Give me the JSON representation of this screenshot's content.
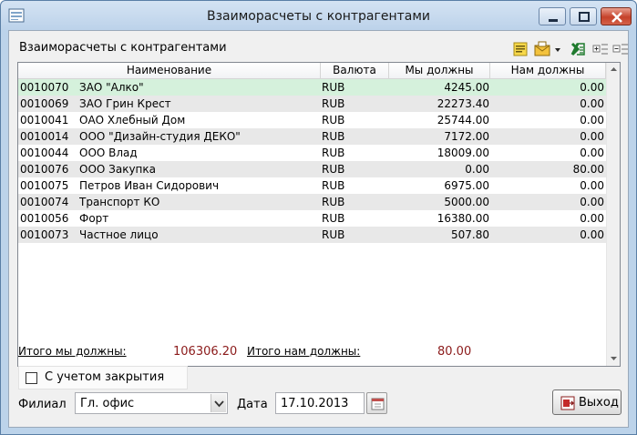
{
  "window": {
    "title": "Взаиморасчеты с контрагентами"
  },
  "panel": {
    "title": "Взаиморасчеты с контрагентами"
  },
  "toolbar": {
    "icons": [
      "note-icon",
      "mail-icon",
      "dropdown-arrow-icon",
      "excel-icon",
      "expand-icon",
      "collapse-icon"
    ]
  },
  "grid": {
    "columns": {
      "name": "Наименование",
      "currency": "Валюта",
      "we_owe": "Мы должны",
      "they_owe": "Нам должны"
    },
    "rows": [
      {
        "code": "0010070",
        "name": "ЗАО \"Алко\"",
        "currency": "RUB",
        "we_owe": "4245.00",
        "they_owe": "0.00"
      },
      {
        "code": "0010069",
        "name": "ЗАО Грин Крест",
        "currency": "RUB",
        "we_owe": "22273.40",
        "they_owe": "0.00"
      },
      {
        "code": "0010041",
        "name": "ОАО Хлебный Дом",
        "currency": "RUB",
        "we_owe": "25744.00",
        "they_owe": "0.00"
      },
      {
        "code": "0010014",
        "name": "ООО \"Дизайн-студия ДЕКО\"",
        "currency": "RUB",
        "we_owe": "7172.00",
        "they_owe": "0.00"
      },
      {
        "code": "0010044",
        "name": "ООО Влад",
        "currency": "RUB",
        "we_owe": "18009.00",
        "they_owe": "0.00"
      },
      {
        "code": "0010076",
        "name": "ООО Закупка",
        "currency": "RUB",
        "we_owe": "0.00",
        "they_owe": "80.00"
      },
      {
        "code": "0010075",
        "name": "Петров Иван Сидорович",
        "currency": "RUB",
        "we_owe": "6975.00",
        "they_owe": "0.00"
      },
      {
        "code": "0010074",
        "name": "Транспорт КО",
        "currency": "RUB",
        "we_owe": "5000.00",
        "they_owe": "0.00"
      },
      {
        "code": "0010056",
        "name": "Форт",
        "currency": "RUB",
        "we_owe": "16380.00",
        "they_owe": "0.00"
      },
      {
        "code": "0010073",
        "name": "Частное лицо",
        "currency": "RUB",
        "we_owe": "507.80",
        "they_owe": "0.00"
      }
    ]
  },
  "summary": {
    "we_owe_label": "Итого мы должны:",
    "we_owe_value": "106306.20",
    "they_owe_label": "Итого нам должны:",
    "they_owe_value": "80.00"
  },
  "filters": {
    "closing_label": "С учетом закрытия",
    "branch_label": "Филиал",
    "branch_value": "Гл. офис",
    "date_label": "Дата",
    "date_value": "17.10.2013"
  },
  "buttons": {
    "exit_label": "Выход"
  },
  "colors": {
    "selected_row": "#d5f1dc",
    "alt_row": "#e8e8e8",
    "total_value": "#8b1a1a"
  }
}
